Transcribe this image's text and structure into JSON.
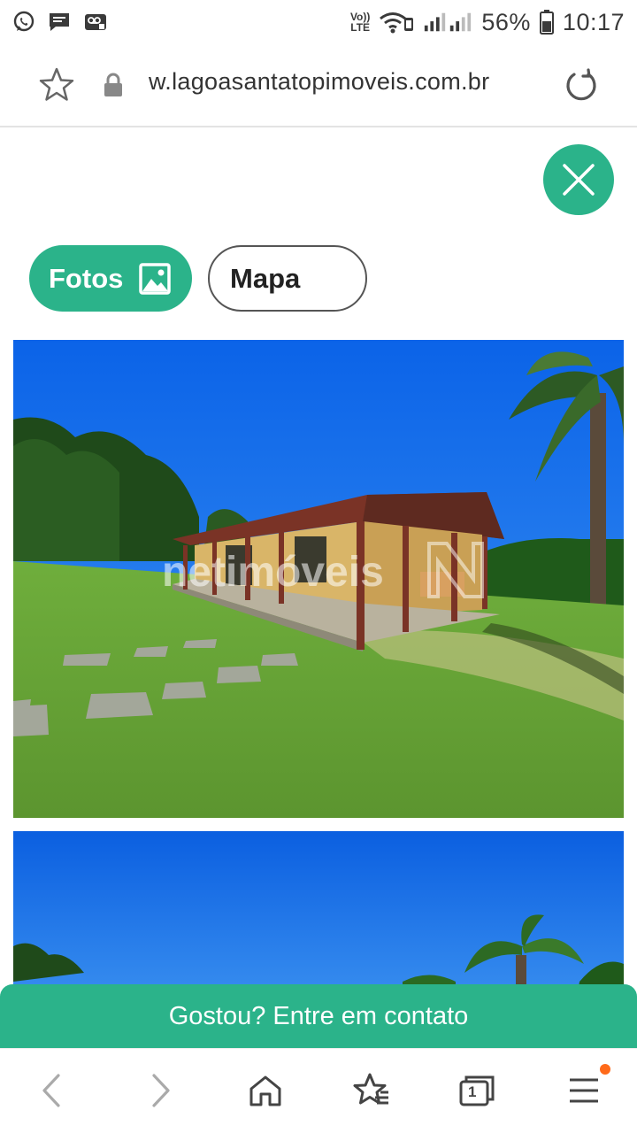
{
  "status_bar": {
    "left_icons": [
      "whatsapp-icon",
      "message-icon",
      "voicemail-icon"
    ],
    "network_label_top": "Vo))",
    "network_label_bottom": "LTE",
    "battery_percent": "56%",
    "time": "10:17"
  },
  "address_bar": {
    "url": "w.lagoasantatopimoveis.com.br",
    "icons": [
      "star-icon",
      "lock-icon",
      "reload-icon"
    ]
  },
  "tabs": {
    "fotos_label": "Fotos",
    "mapa_label": "Mapa"
  },
  "watermark": "netimóveis",
  "contact": {
    "label": "Gostou? Entre em contato"
  },
  "bottom_nav": {
    "tabs_count": "1",
    "icons": [
      "back-icon",
      "forward-icon",
      "home-icon",
      "bookmarks-icon",
      "tabs-icon",
      "menu-icon"
    ]
  },
  "colors": {
    "accent": "#2bb38a",
    "notification": "#ff6a1a"
  }
}
